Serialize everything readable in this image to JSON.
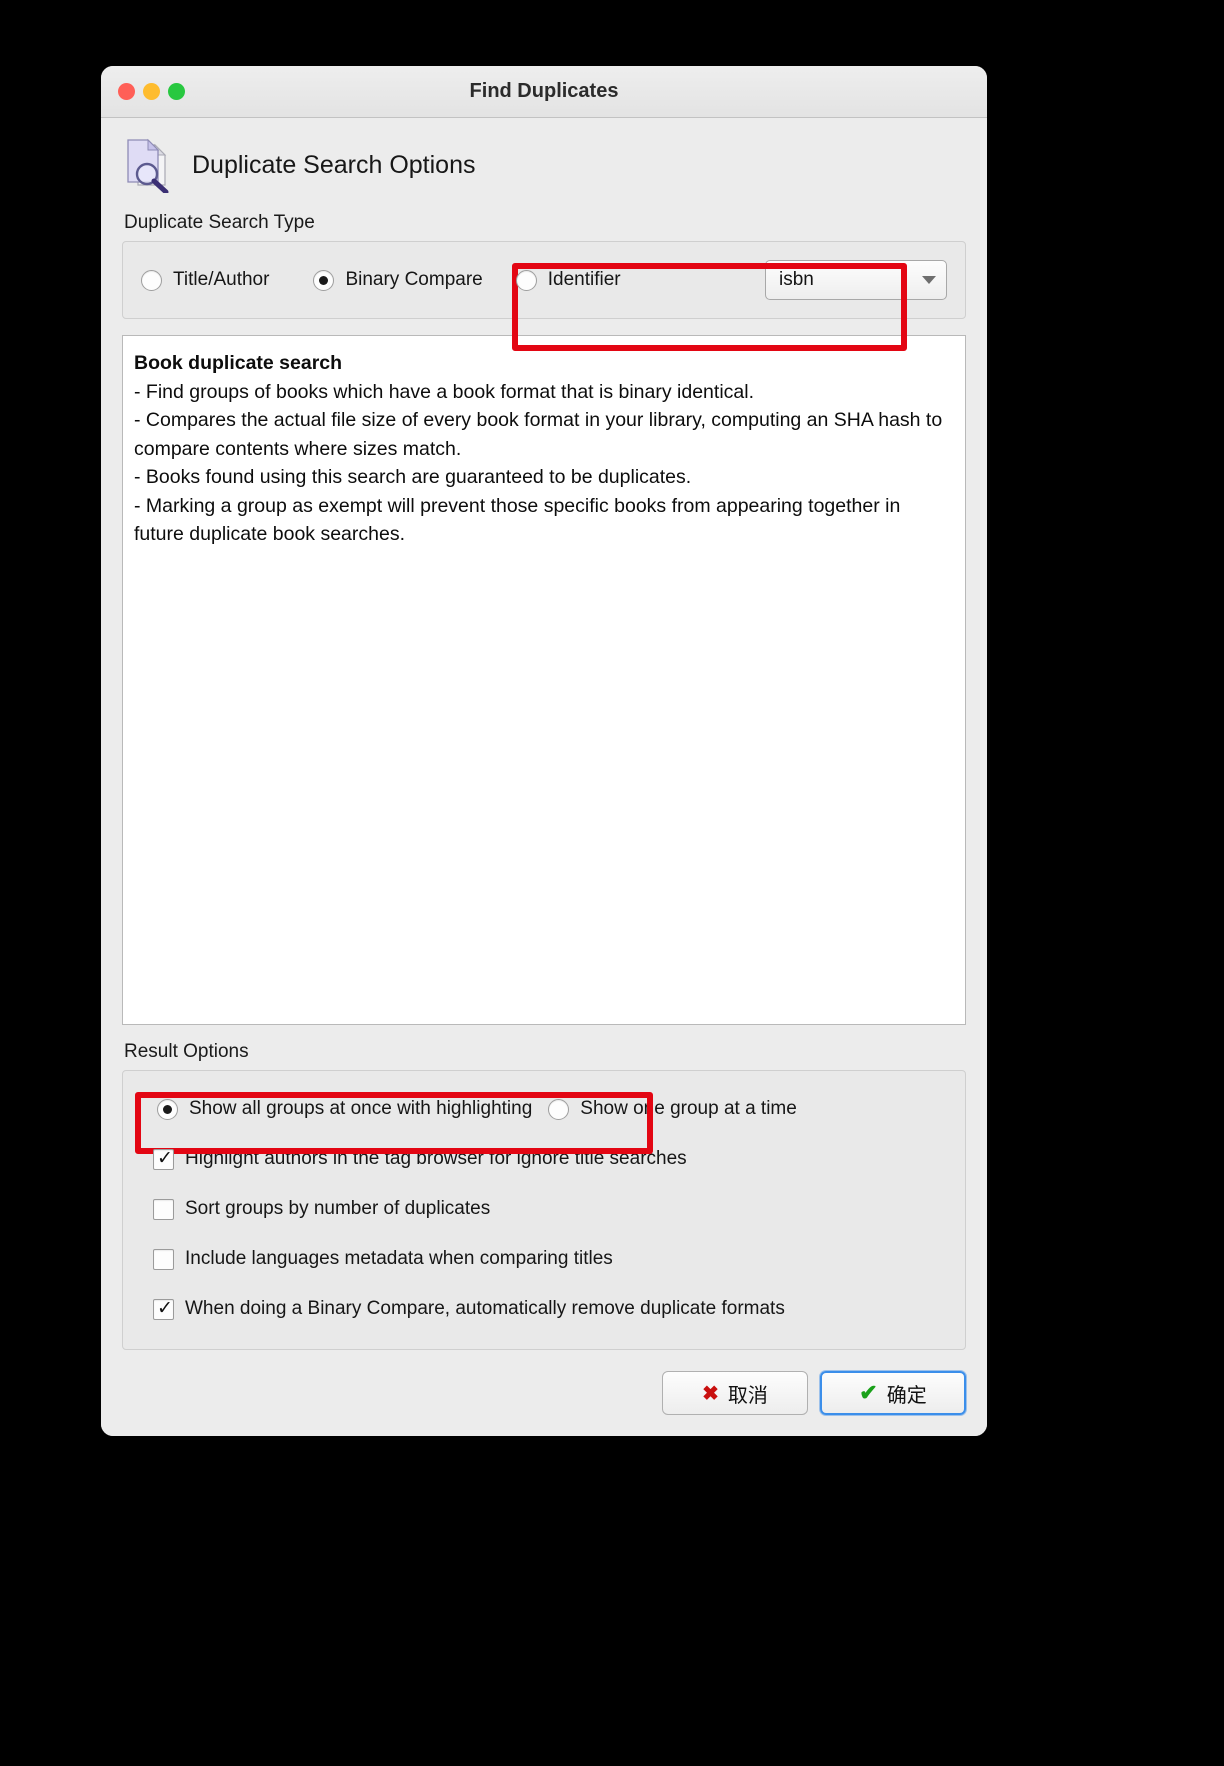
{
  "window": {
    "title": "Find Duplicates",
    "traffic_lights": [
      "close-red",
      "minimize-yellow",
      "zoom-green"
    ]
  },
  "header": {
    "icon": "document-magnifier-icon",
    "title": "Duplicate Search Options"
  },
  "search_type": {
    "group_label": "Duplicate Search Type",
    "options": [
      {
        "label": "Title/Author",
        "selected": false
      },
      {
        "label": "Binary Compare",
        "selected": true
      },
      {
        "label": "Identifier",
        "selected": false
      }
    ],
    "identifier_dropdown": {
      "value": "isbn",
      "icon": "chevron-down-icon"
    }
  },
  "description": {
    "heading": "Book duplicate search",
    "lines": [
      "- Find groups of books which have a book format that is binary identical.",
      "- Compares the actual file size of every book format in your library, computing an SHA hash to compare contents where sizes match.",
      "- Books found using this search are guaranteed to be duplicates.",
      "- Marking a group as exempt will prevent those specific books from appearing together in future duplicate book searches."
    ]
  },
  "result_options": {
    "group_label": "Result Options",
    "radios": [
      {
        "label": "Show all groups at once with highlighting",
        "selected": true
      },
      {
        "label": "Show one group at a time",
        "selected": false
      }
    ],
    "checkboxes": [
      {
        "label": "Highlight authors in the tag browser for ignore title searches",
        "checked": true
      },
      {
        "label": "Sort groups by number of duplicates",
        "checked": false
      },
      {
        "label": "Include languages metadata when comparing titles",
        "checked": false
      },
      {
        "label": "When doing a Binary Compare, automatically remove duplicate formats",
        "checked": true
      }
    ]
  },
  "footer": {
    "cancel_button": {
      "label": "取消",
      "icon": "cross-icon"
    },
    "ok_button": {
      "label": "确定",
      "icon": "check-icon",
      "focused": true
    }
  },
  "annotations": {
    "highlight_color": "#e30613",
    "boxes": [
      "search-type-binary-identifier",
      "result-show-all-groups"
    ]
  }
}
